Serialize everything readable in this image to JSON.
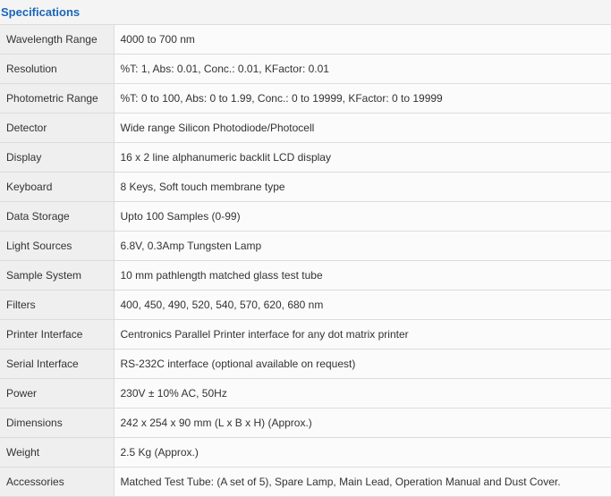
{
  "section": {
    "title": "Specifications"
  },
  "rows": [
    {
      "label": "Wavelength Range",
      "value": "4000 to 700 nm"
    },
    {
      "label": "Resolution",
      "value": "%T: 1, Abs: 0.01, Conc.: 0.01, KFactor: 0.01"
    },
    {
      "label": "Photometric Range",
      "value": "%T: 0 to 100, Abs: 0 to 1.99, Conc.: 0 to 19999, KFactor: 0 to 19999"
    },
    {
      "label": "Detector",
      "value": "Wide range Silicon Photodiode/Photocell"
    },
    {
      "label": "Display",
      "value": "16 x 2 line alphanumeric backlit LCD display"
    },
    {
      "label": "Keyboard",
      "value": "8 Keys, Soft touch membrane type"
    },
    {
      "label": "Data Storage",
      "value": "Upto 100 Samples (0-99)"
    },
    {
      "label": "Light Sources",
      "value": "6.8V, 0.3Amp Tungsten Lamp"
    },
    {
      "label": "Sample System",
      "value": "10 mm pathlength matched glass test tube"
    },
    {
      "label": "Filters",
      "value": "400, 450, 490, 520, 540, 570, 620, 680 nm"
    },
    {
      "label": "Printer Interface",
      "value": "Centronics Parallel Printer interface for any dot matrix printer"
    },
    {
      "label": "Serial Interface",
      "value": "RS-232C interface (optional available on request)"
    },
    {
      "label": "Power",
      "value": "230V ± 10% AC, 50Hz"
    },
    {
      "label": "Dimensions",
      "value": "242 x 254 x 90 mm (L x B x H) (Approx.)"
    },
    {
      "label": "Weight",
      "value": "2.5 Kg (Approx.)"
    },
    {
      "label": "Accessories",
      "value": "Matched Test Tube: (A set of 5), Spare Lamp, Main Lead, Operation Manual and Dust Cover."
    }
  ]
}
